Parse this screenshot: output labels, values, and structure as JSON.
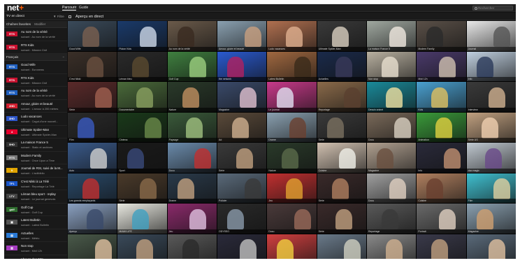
{
  "app": {
    "logo_text": "net",
    "logo_plus": "+",
    "nav": [
      "Parcourir",
      "Guide"
    ],
    "search_placeholder": "Rechercher"
  },
  "subheader": {
    "left_title": "TV en direct",
    "filter_label": "▼ Filtre",
    "content_title": "Aperçu en direct"
  },
  "sidebar": {
    "favorites_label": "Chaînes favorites",
    "edit_label": "Modifier",
    "favorites": [
      {
        "logo": "RTS",
        "logo_color": "#c8102e",
        "title": "Au nom de la vérité",
        "next": "suivant : Au nom de la vérité"
      },
      {
        "logo": "RTS",
        "logo_color": "#c8102e",
        "title": "RTS Kids",
        "next": "suivant : Mission Civil"
      }
    ],
    "section_label": "Français",
    "channels": [
      {
        "logo": "RTS",
        "logo_color": "#1f5fbf",
        "title": "Good Wife",
        "next": "suivant : Euronews"
      },
      {
        "logo": "RTS",
        "logo_color": "#c8102e",
        "title": "RTS Kids",
        "next": "suivant : Mission Civil"
      },
      {
        "logo": "RTS",
        "logo_color": "#1f5fbf",
        "title": "Au nom de la vérité",
        "next": "suivant : Au nom de la vérité"
      },
      {
        "logo": "2HD",
        "logo_color": "#d11f2f",
        "title": "Amour, gloire et beauté",
        "next": "suivant : L'amour à 200 mètres"
      },
      {
        "logo": "3HD",
        "logo_color": "#2e56c9",
        "title": "Ludo vacances",
        "next": "suivant : Cagot-d'une nouvell..."
      },
      {
        "logo": "4",
        "logo_color": "#e4002b",
        "title": "Ultimate Spider-Man",
        "next": "suivant : Ultimate Spider-Man"
      },
      {
        "logo": "5HD",
        "logo_color": "#333333",
        "title": "La maison France 5",
        "next": "suivant : Static et archives"
      },
      {
        "logo": "RTS",
        "logo_color": "#777777",
        "title": "Modern Family",
        "next": "suivant : Once Upon a Time"
      },
      {
        "logo": "9",
        "logo_color": "#e0a400",
        "title": "Journal de RSI, suivi de la M...",
        "next": "suivant : L'actibiblio"
      },
      {
        "logo": "TF1",
        "logo_color": "#1a56c9",
        "title": "C'est Nikki à La Télé",
        "next": "suivant : Reportage La Télé"
      },
      {
        "logo": "LTV",
        "logo_color": "#444444",
        "title": "Léman bleu sport - replay",
        "next": "suivant : Le journal genevois"
      },
      {
        "logo": "golf",
        "logo_color": "#2f6d2f",
        "title": "Golf Cup",
        "next": "suivant : Golf Cup"
      },
      {
        "logo": "▣",
        "logo_color": "#555555",
        "title": "Latest Bulletin",
        "next": "suivant : Latest Bulletin"
      },
      {
        "logo": "▤",
        "logo_color": "#2a7ad6",
        "title": "Actuelles",
        "next": "suivant : Météo"
      },
      {
        "logo": "▥",
        "logo_color": "#a53cc0",
        "title": "Non stop",
        "next": "suivant : Midi 12h"
      },
      {
        "logo": "",
        "logo_color": "#191919",
        "title": "L'heure des 60's",
        "next": ""
      }
    ]
  },
  "grid": {
    "tiles": [
      {
        "caption": "Good Wife",
        "bg": "#3a4a5a",
        "fig": "#7a6050"
      },
      {
        "caption": "Pluton Kids",
        "bg": "#1a3a6a",
        "fig": "#cdd8e8"
      },
      {
        "caption": "Au nom de la vérité",
        "bg": "#6a5a4a",
        "fig": "#3a2a20"
      },
      {
        "caption": "Amour, gloire et beauté",
        "bg": "#8aa0b0",
        "fig": "#c9a080"
      },
      {
        "caption": "Ludo vacances",
        "bg": "#b07050",
        "fig": "#e0b090"
      },
      {
        "caption": "Ultimate Spider-Man",
        "bg": "#3a3a3a",
        "fig": "#d9d0c0"
      },
      {
        "caption": "La maison France 5",
        "bg": "#a0a8a0",
        "fig": "#f0e8e0"
      },
      {
        "caption": "Modern Family",
        "bg": "#5a5048",
        "fig": "#2a2a2a"
      },
      {
        "caption": "Journal",
        "bg": "#e8e8e8",
        "fig": "#555555"
      },
      {
        "caption": "C'est Nikki",
        "bg": "#3a2f28",
        "fig": "#6a5040"
      },
      {
        "caption": "Léman bleu",
        "bg": "#2a2a2a",
        "fig": "#5a4a30"
      },
      {
        "caption": "Golf Cup",
        "bg": "#3f7f3f",
        "fig": "#9ccf7f"
      },
      {
        "caption": "the network",
        "bg": "#2a5ad0",
        "fig": "#b02060"
      },
      {
        "caption": "Latest Bulletin",
        "bg": "#a06840",
        "fig": "#3a2a1a"
      },
      {
        "caption": "Actuelles",
        "bg": "#1a2a4a",
        "fig": "#3a3a5a"
      },
      {
        "caption": "Non stop",
        "bg": "#b8b0a0",
        "fig": "#e8e0d0"
      },
      {
        "caption": "Midi 12h",
        "bg": "#4a3a6a",
        "fig": "#d0c0b0"
      },
      {
        "caption": "Info",
        "bg": "#c0d0e0",
        "fig": "#2a3a5a"
      },
      {
        "caption": "Série",
        "bg": "#5a2a2a",
        "fig": "#a06050"
      },
      {
        "caption": "Documentaire",
        "bg": "#4a6a3a",
        "fig": "#8aa060"
      },
      {
        "caption": "Nature",
        "bg": "#2a3a2a",
        "fig": "#c09060"
      },
      {
        "caption": "Magazine",
        "bg": "#3a4a6a",
        "fig": "#e0c0d0"
      },
      {
        "caption": "Le journal",
        "bg": "#c83a8a",
        "fig": "#e0e0f0"
      },
      {
        "caption": "Reportage",
        "bg": "#8a6a4a",
        "fig": "#5a4030"
      },
      {
        "caption": "Dessin animé",
        "bg": "#1a8a9a",
        "fig": "#f0e0a0"
      },
      {
        "caption": "Kids",
        "bg": "#4aa0d0",
        "fig": "#e0c060"
      },
      {
        "caption": "Interview",
        "bg": "#3a3a3a",
        "fig": "#d0b090"
      },
      {
        "caption": "Film",
        "bg": "#2a2a2a",
        "fig": "#3a5ac0"
      },
      {
        "caption": "Cinéma",
        "bg": "#1a3a1a",
        "fig": "#6a8a4a"
      },
      {
        "caption": "Paysage",
        "bg": "#3a5a3a",
        "fig": "#a0c080"
      },
      {
        "caption": "Ad",
        "bg": "#5a4a3a",
        "fig": "#d0b090"
      },
      {
        "caption": "Drame",
        "bg": "#8aa0b0",
        "fig": "#6a4030"
      },
      {
        "caption": "Série",
        "bg": "#3a3a3a",
        "fig": "#7a7060"
      },
      {
        "caption": "Docu",
        "bg": "#7a6a5a",
        "fig": "#d8d0c0"
      },
      {
        "caption": "Animation",
        "bg": "#3a9a3a",
        "fig": "#e0d040"
      },
      {
        "caption": "Série US",
        "bg": "#c0a080",
        "fig": "#f0d0b0"
      },
      {
        "caption": "Auto",
        "bg": "#3a5a8a",
        "fig": "#d0d0d0"
      },
      {
        "caption": "Sport",
        "bg": "#1a1a1a",
        "fig": "#3a4a7a"
      },
      {
        "caption": "Docu",
        "bg": "#6a8aaa",
        "fig": "#c03030"
      },
      {
        "caption": "Série",
        "bg": "#3a3a3a",
        "fig": "#c0a080"
      },
      {
        "caption": "Nature",
        "bg": "#2a3a2a",
        "fig": "#5a6a4a"
      },
      {
        "caption": "Cuisine",
        "bg": "#d0c0b0",
        "fig": "#f0f0e8"
      },
      {
        "caption": "Magazine",
        "bg": "#b0a090",
        "fig": "#6a5040"
      },
      {
        "caption": "Info",
        "bg": "#2a2a3a",
        "fig": "#c09070"
      },
      {
        "caption": "duo magic",
        "bg": "#c0c8d0",
        "fig": "#6a4a8a"
      },
      {
        "caption": "Les grands remplaçants",
        "bg": "#2a4a6a",
        "fig": "#c03030"
      },
      {
        "caption": "Série",
        "bg": "#4a3a2a",
        "fig": "#8a6a4a"
      },
      {
        "caption": "Drame",
        "bg": "#2a3a4a",
        "fig": "#c0a080"
      },
      {
        "caption": "Policier",
        "bg": "#5a6a7a",
        "fig": "#3a3a3a"
      },
      {
        "caption": "Jeu",
        "bg": "#c03030",
        "fig": "#e0a030"
      },
      {
        "caption": "Série",
        "bg": "#3a2a2a",
        "fig": "#b08060"
      },
      {
        "caption": "Docu",
        "bg": "#a0a0a0",
        "fig": "#e0d0c0"
      },
      {
        "caption": "Cuisine",
        "bg": "#b08060",
        "fig": "#6a4030"
      },
      {
        "caption": "Film",
        "bg": "#40c0d0",
        "fig": "#e0d0a0"
      },
      {
        "caption": "Aperçu",
        "bg": "#8aa0c0",
        "fig": "#3a4a6a"
      },
      {
        "caption": "MIAMI LIFE",
        "bg": "#e8e8e0",
        "fig": "#40a0c0"
      },
      {
        "caption": "Jeu",
        "bg": "#8a2a6a",
        "fig": "#e0c0e0"
      },
      {
        "caption": "ODYSSO",
        "bg": "#2a2a2a",
        "fig": "#8a9aaa"
      },
      {
        "caption": "Docu",
        "bg": "#4a3a3a",
        "fig": "#9a6a5a"
      },
      {
        "caption": "Série",
        "bg": "#3a2a2a",
        "fig": "#c0a080"
      },
      {
        "caption": "Reportage",
        "bg": "#5a5a5a",
        "fig": "#3a3a3a"
      },
      {
        "caption": "Portrait",
        "bg": "#6a6a6a",
        "fig": "#e0d0c0"
      },
      {
        "caption": "Magazine",
        "bg": "#8aa0b0",
        "fig": "#d0a070"
      },
      {
        "caption": "Sport",
        "bg": "#4a5a4a",
        "fig": "#e0c0a0"
      },
      {
        "caption": "Info",
        "bg": "#3a4a5a",
        "fig": "#c0a080"
      },
      {
        "caption": "Voiture",
        "bg": "#5a5a5a",
        "fig": "#2a2a2a"
      },
      {
        "caption": "Série",
        "bg": "#2a2a3a",
        "fig": "#c0c0c0"
      },
      {
        "caption": "Kiki Ninja",
        "bg": "#d04040",
        "fig": "#f0d040"
      },
      {
        "caption": "Docu",
        "bg": "#6a7a8a",
        "fig": "#d0d0c0"
      },
      {
        "caption": "Interview",
        "bg": "#8a8a8a",
        "fig": "#d0b090"
      },
      {
        "caption": "Série",
        "bg": "#3a3a4a",
        "fig": "#c0a080"
      },
      {
        "caption": "Info",
        "bg": "#5a6a7a",
        "fig": "#e0c0a0"
      }
    ]
  },
  "colors": {
    "accent": "#ff5a00",
    "background": "#111111",
    "sidebar": "#191919"
  }
}
